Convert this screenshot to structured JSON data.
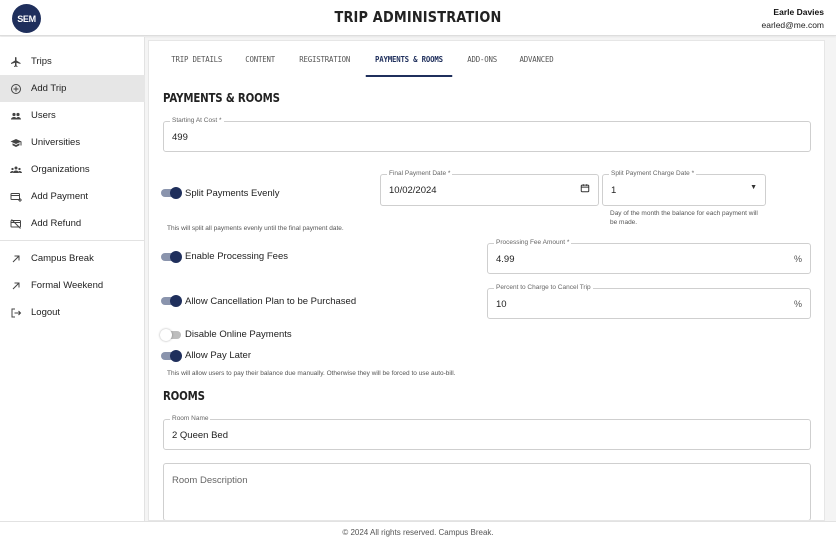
{
  "header": {
    "logo_text": "SEM",
    "title": "TRIP ADMINISTRATION",
    "user_name": "Earle Davies",
    "user_email": "earled@me.com"
  },
  "sidebar": {
    "items": [
      {
        "label": "Trips",
        "icon": "airplane-icon"
      },
      {
        "label": "Add Trip",
        "icon": "plus-circle-icon",
        "active": true
      },
      {
        "label": "Users",
        "icon": "users-icon"
      },
      {
        "label": "Universities",
        "icon": "graduation-cap-icon"
      },
      {
        "label": "Organizations",
        "icon": "organizations-icon"
      },
      {
        "label": "Add Payment",
        "icon": "add-payment-icon"
      },
      {
        "label": "Add Refund",
        "icon": "refund-icon"
      },
      {
        "label": "Campus Break",
        "icon": "external-arrow-icon"
      },
      {
        "label": "Formal Weekend",
        "icon": "external-arrow-icon"
      },
      {
        "label": "Logout",
        "icon": "logout-icon"
      }
    ]
  },
  "tabs": [
    "TRIP DETAILS",
    "CONTENT",
    "REGISTRATION",
    "PAYMENTS & ROOMS",
    "ADD-ONS",
    "ADVANCED"
  ],
  "active_tab": "PAYMENTS & ROOMS",
  "payments": {
    "section_title": "PAYMENTS & ROOMS",
    "starting_cost": {
      "label": "Starting At Cost *",
      "value": "499"
    },
    "split_evenly": {
      "label": "Split Payments Evenly",
      "on": true,
      "helper": "This will split all payments evenly until the final payment date."
    },
    "final_payment_date": {
      "label": "Final Payment Date *",
      "value": "10/02/2024"
    },
    "split_charge_date": {
      "label": "Split Payment Charge Date *",
      "value": "1",
      "helper": "Day of the month the balance for each payment will be made."
    },
    "processing_fees": {
      "label": "Enable Processing Fees",
      "on": true
    },
    "processing_fee_amount": {
      "label": "Processing Fee Amount *",
      "value": "4.99",
      "suffix": "%"
    },
    "cancellation_plan": {
      "label": "Allow Cancellation Plan to be Purchased",
      "on": true
    },
    "cancel_percent": {
      "label": "Percent to Charge to Cancel Trip",
      "value": "10",
      "suffix": "%"
    },
    "disable_online": {
      "label": "Disable Online Payments",
      "on": false
    },
    "pay_later": {
      "label": "Allow Pay Later",
      "on": true,
      "helper": "This will allow users to pay their balance due manually. Otherwise they will be forced to use auto-bill."
    }
  },
  "rooms": {
    "section_title": "ROOMS",
    "room_name": {
      "label": "Room Name",
      "value": "2 Queen Bed"
    },
    "room_description": {
      "placeholder": "Room Description"
    }
  },
  "footer": {
    "text": "© 2024 All rights reserved. Campus Break."
  },
  "colors": {
    "accent": "#1f2f5c",
    "toggle_track_on": "#8a94ad",
    "sidebar_active": "#e6e6e6"
  }
}
